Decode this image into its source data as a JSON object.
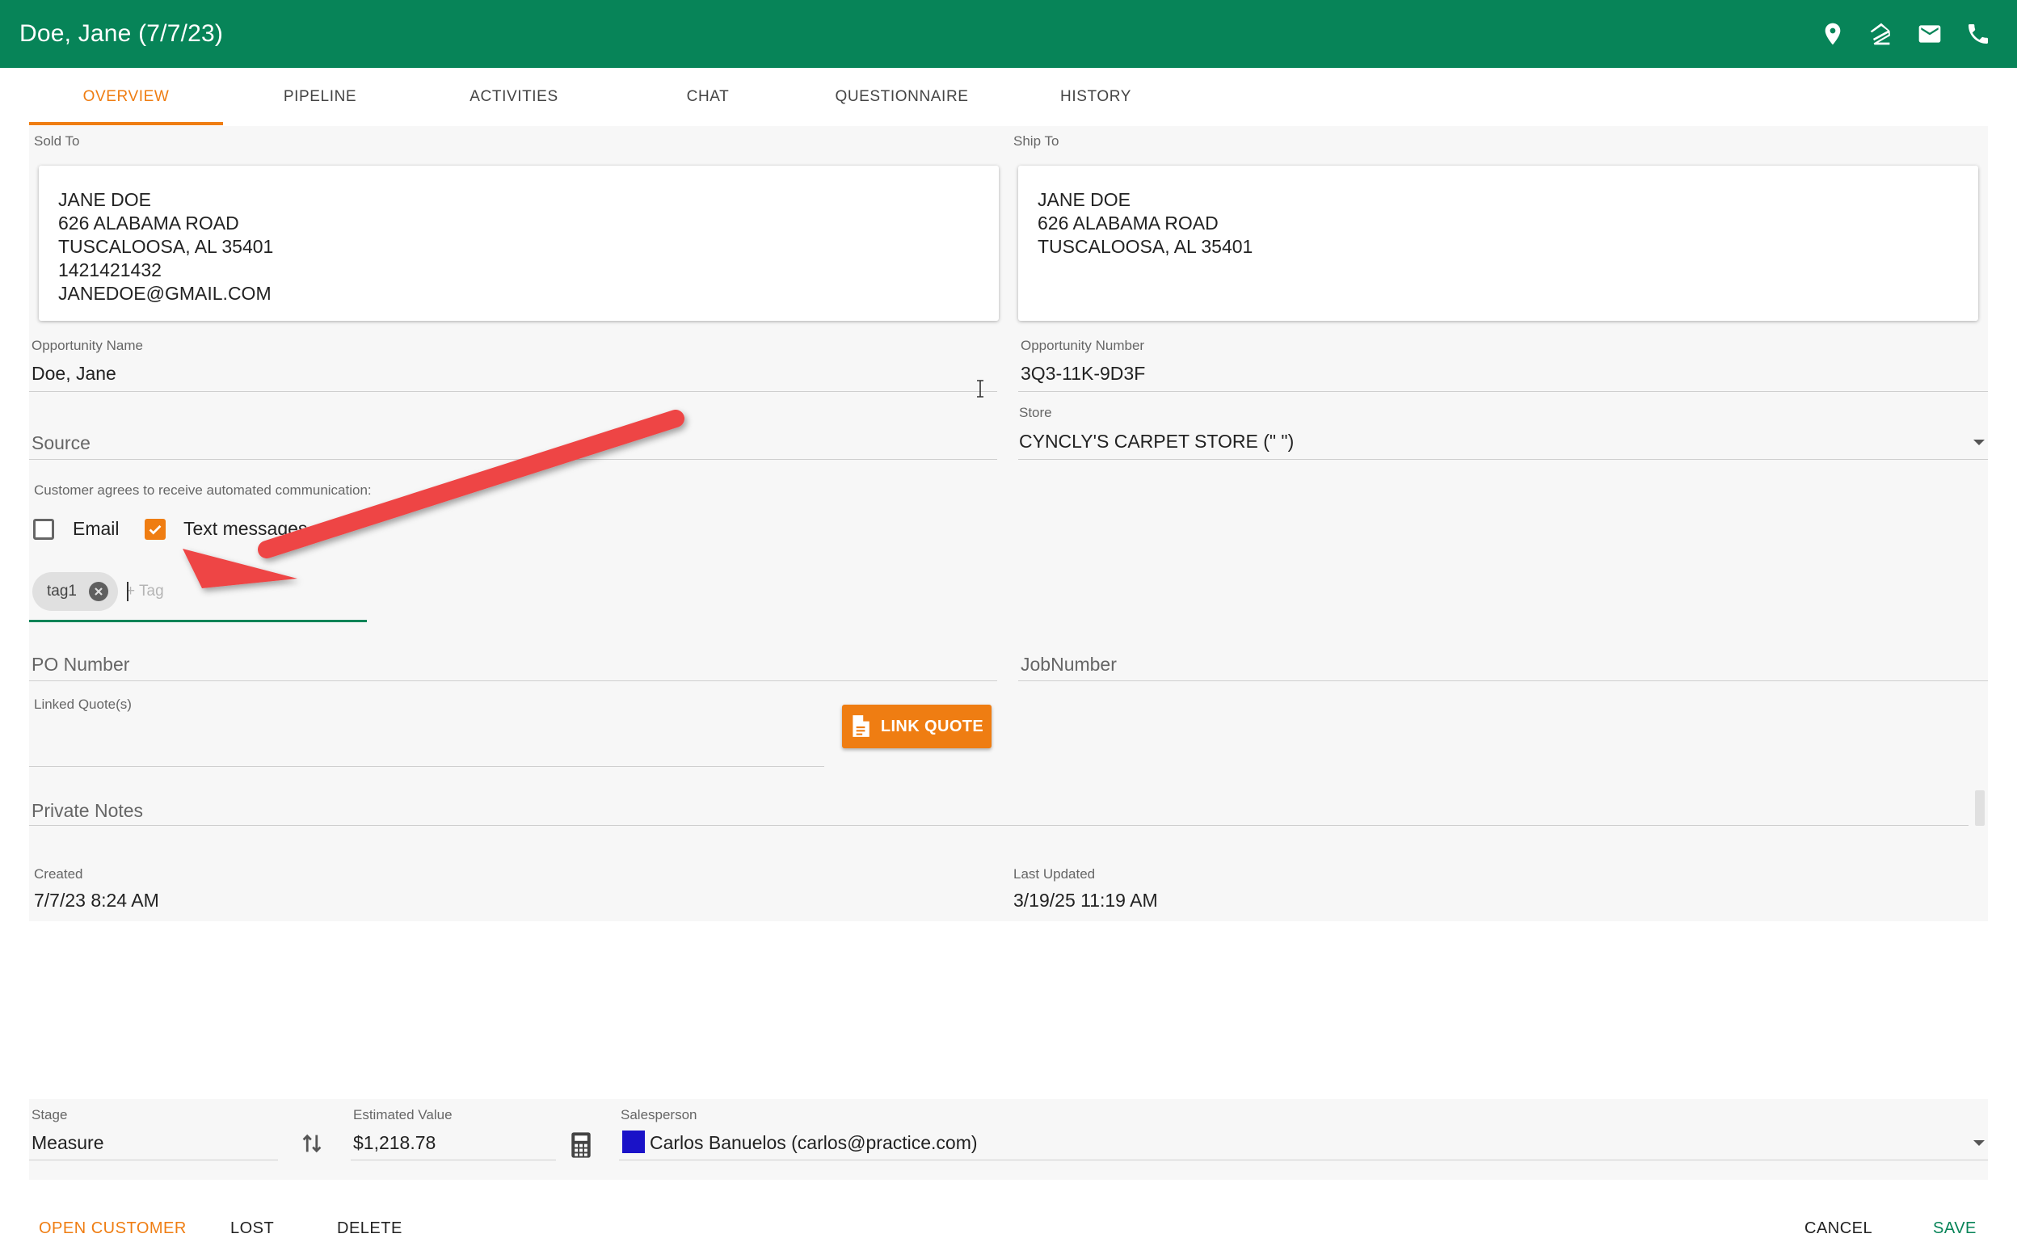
{
  "header": {
    "title": "Doe, Jane (7/7/23)",
    "icons": [
      "location-pin-icon",
      "zillow-icon",
      "mail-icon",
      "phone-icon"
    ]
  },
  "tabs": [
    "OVERVIEW",
    "PIPELINE",
    "ACTIVITIES",
    "CHAT",
    "QUESTIONNAIRE",
    "HISTORY"
  ],
  "active_tab": "OVERVIEW",
  "sold_to": {
    "label": "Sold To",
    "lines": [
      "JANE DOE",
      "626 ALABAMA ROAD",
      "TUSCALOOSA, AL 35401",
      "1421421432",
      "JANEDOE@GMAIL.COM"
    ]
  },
  "ship_to": {
    "label": "Ship To",
    "lines": [
      "JANE DOE",
      "626 ALABAMA ROAD",
      "TUSCALOOSA, AL 35401"
    ]
  },
  "opportunity_name": {
    "label": "Opportunity Name",
    "value": "Doe, Jane"
  },
  "opportunity_number": {
    "label": "Opportunity Number",
    "value": "3Q3-11K-9D3F"
  },
  "source": {
    "placeholder": "Source"
  },
  "store": {
    "label": "Store",
    "value": "CYNCLY'S CARPET STORE (\" \")"
  },
  "communication": {
    "label": "Customer agrees to receive automated communication:",
    "email": {
      "label": "Email",
      "checked": false
    },
    "text": {
      "label": "Text messages",
      "checked": true
    }
  },
  "tags": {
    "chips": [
      "tag1"
    ],
    "placeholder": "+ Tag"
  },
  "po_number": {
    "placeholder": "PO Number"
  },
  "job_number": {
    "placeholder": "JobNumber"
  },
  "linked_quotes": {
    "label": "Linked Quote(s)",
    "button": "LINK QUOTE"
  },
  "private_notes": {
    "placeholder": "Private Notes"
  },
  "created": {
    "label": "Created",
    "value": "7/7/23 8:24 AM"
  },
  "last_updated": {
    "label": "Last Updated",
    "value": "3/19/25 11:19 AM"
  },
  "stage": {
    "label": "Stage",
    "value": "Measure"
  },
  "estimated_value": {
    "label": "Estimated Value",
    "value": "$1,218.78"
  },
  "salesperson": {
    "label": "Salesperson",
    "value": "Carlos Banuelos (carlos@practice.com)",
    "color": "#1a12c8"
  },
  "footer": {
    "open_customer": "OPEN CUSTOMER",
    "lost": "LOST",
    "delete": "DELETE",
    "cancel": "CANCEL",
    "save": "SAVE"
  },
  "colors": {
    "header": "#078458",
    "accent": "#ef7d12",
    "annotation_arrow": "#ee4444"
  }
}
